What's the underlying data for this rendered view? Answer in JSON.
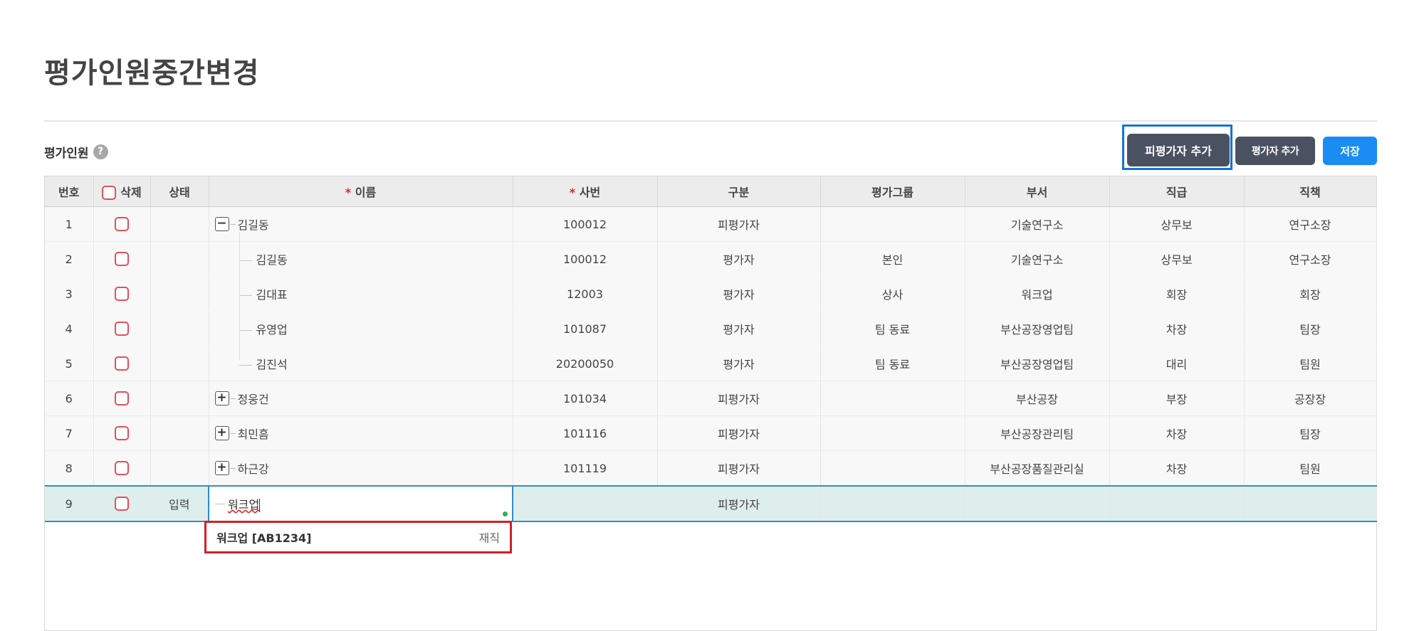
{
  "page": {
    "title": "평가인원중간변경"
  },
  "section": {
    "label": "평가인원",
    "help_icon": "?"
  },
  "toolbar": {
    "add_evaluatee": "피평가자 추가",
    "add_evaluator": "평가자 추가",
    "save": "저장"
  },
  "colors": {
    "primary": "#1a8cf3",
    "dark_button": "#4a5160",
    "required": "#e0262e",
    "highlight_box": "#d0202a"
  },
  "table": {
    "headers": {
      "no": "번호",
      "delete": "삭제",
      "status": "상태",
      "name_req": "*",
      "name": " 이름",
      "empno_req": "*",
      "empno": " 사번",
      "type": "구분",
      "group": "평가그룹",
      "dept": "부서",
      "grade": "직급",
      "duty": "직책"
    },
    "rows": [
      {
        "no": "1",
        "status": "",
        "toggle": "−",
        "name": "김길동",
        "empno": "100012",
        "type": "피평가자",
        "group": "",
        "dept": "기술연구소",
        "grade": "상무보",
        "duty": "연구소장"
      },
      {
        "no": "2",
        "status": "",
        "name": "김길동",
        "empno": "100012",
        "type": "평가자",
        "group": "본인",
        "dept": "기술연구소",
        "grade": "상무보",
        "duty": "연구소장"
      },
      {
        "no": "3",
        "status": "",
        "name": "김대표",
        "empno": "12003",
        "type": "평가자",
        "group": "상사",
        "dept": "워크업",
        "grade": "회장",
        "duty": "회장"
      },
      {
        "no": "4",
        "status": "",
        "name": "유영업",
        "empno": "101087",
        "type": "평가자",
        "group": "팀 동료",
        "dept": "부산공장영업팀",
        "grade": "차장",
        "duty": "팀장"
      },
      {
        "no": "5",
        "status": "",
        "name": "김진석",
        "empno": "20200050",
        "type": "평가자",
        "group": "팀 동료",
        "dept": "부산공장영업팀",
        "grade": "대리",
        "duty": "팀원"
      },
      {
        "no": "6",
        "status": "",
        "toggle": "+",
        "name": "정웅건",
        "empno": "101034",
        "type": "피평가자",
        "group": "",
        "dept": "부산공장",
        "grade": "부장",
        "duty": "공장장"
      },
      {
        "no": "7",
        "status": "",
        "toggle": "+",
        "name": "최민흠",
        "empno": "101116",
        "type": "피평가자",
        "group": "",
        "dept": "부산공장관리팀",
        "grade": "차장",
        "duty": "팀장"
      },
      {
        "no": "8",
        "status": "",
        "toggle": "+",
        "name": "하근강",
        "empno": "101119",
        "type": "피평가자",
        "group": "",
        "dept": "부산공장품질관리실",
        "grade": "차장",
        "duty": "팀원"
      },
      {
        "no": "9",
        "status": "입력",
        "name_input": "워크업",
        "empno": "",
        "type": "피평가자",
        "group": "",
        "dept": "",
        "grade": "",
        "duty": ""
      }
    ]
  },
  "suggestion": {
    "name": "워크업 [AB1234]",
    "status": "재직"
  }
}
